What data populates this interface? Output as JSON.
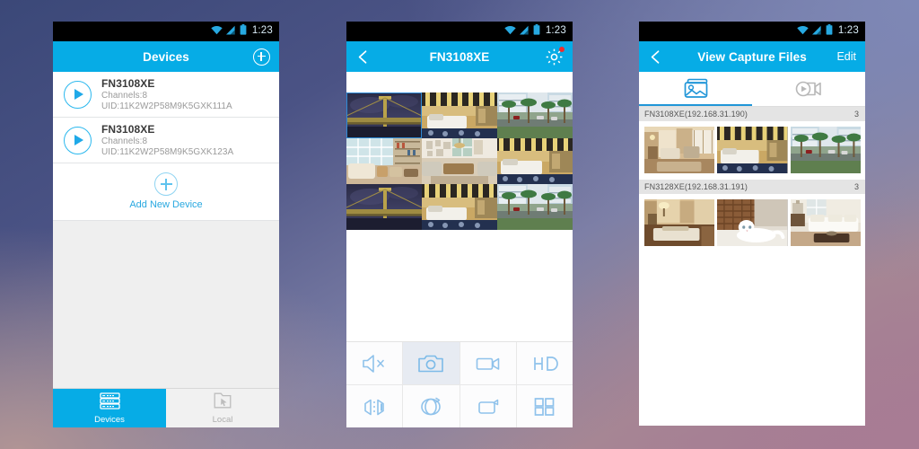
{
  "statusbar": {
    "time": "1:23",
    "wifi_icon": "wifi-icon",
    "signal_icon": "signal-bars-icon",
    "battery_icon": "battery-icon"
  },
  "phone1": {
    "appbar": {
      "title": "Devices",
      "add_icon": "plus-circle-icon"
    },
    "devices": [
      {
        "name": "FN3108XE",
        "channels": "Channels:8",
        "uid": "UID:11K2W2P58M9K5GXK111A",
        "play_icon": "play-icon"
      },
      {
        "name": "FN3108XE",
        "channels": "Channels:8",
        "uid": "UID:11K2W2P58M9K5GXK123A",
        "play_icon": "play-icon"
      }
    ],
    "add_new": {
      "label": "Add New Device",
      "icon": "plus-circle-icon"
    },
    "tabs": [
      {
        "label": "Devices",
        "icon": "server-rack-icon",
        "active": true
      },
      {
        "label": "Local",
        "icon": "folder-cursor-icon",
        "active": false
      }
    ]
  },
  "phone2": {
    "appbar": {
      "title": "FN3108XE",
      "back_icon": "back-chevron-icon",
      "settings_icon": "gear-icon",
      "badge": true
    },
    "grid": {
      "rows": 3,
      "cols": 3,
      "cells": [
        {
          "scene": "bridge-night",
          "selected": true
        },
        {
          "scene": "hotel-room",
          "selected": false
        },
        {
          "scene": "street-palms",
          "selected": false
        },
        {
          "scene": "sunroom",
          "selected": false
        },
        {
          "scene": "living-room",
          "selected": false
        },
        {
          "scene": "hotel-room",
          "selected": false
        },
        {
          "scene": "bridge-night",
          "selected": false
        },
        {
          "scene": "hotel-room",
          "selected": false
        },
        {
          "scene": "street-palms",
          "selected": false
        }
      ]
    },
    "controls": [
      {
        "name": "mute-button",
        "icon": "speaker-mute-icon",
        "active": false
      },
      {
        "name": "snapshot-button",
        "icon": "camera-icon",
        "active": true
      },
      {
        "name": "record-button",
        "icon": "video-camera-icon",
        "active": false
      },
      {
        "name": "quality-button",
        "icon": "hd-icon",
        "active": false
      },
      {
        "name": "mirror-button",
        "icon": "flip-mirror-icon",
        "active": false
      },
      {
        "name": "ptz-button",
        "icon": "ptz-rotate-icon",
        "active": false
      },
      {
        "name": "fullscreen-button",
        "icon": "fullscreen-icon",
        "active": false
      },
      {
        "name": "layout-button",
        "icon": "grid-four-icon",
        "active": false
      }
    ]
  },
  "phone3": {
    "appbar": {
      "title": "View Capture Files",
      "back_icon": "back-chevron-icon",
      "edit_label": "Edit"
    },
    "media_tabs": [
      {
        "name": "photos-tab",
        "icon": "photo-stack-icon",
        "active": true
      },
      {
        "name": "videos-tab",
        "icon": "video-play-icon",
        "active": false
      }
    ],
    "groups": [
      {
        "name": "FN3108XE(192.168.31.190)",
        "count": "3",
        "thumbs": [
          {
            "scene": "warm-suite"
          },
          {
            "scene": "hotel-room"
          },
          {
            "scene": "street-palms"
          }
        ]
      },
      {
        "name": "FN3128XE(192.168.31.191)",
        "count": "3",
        "thumbs": [
          {
            "scene": "bedroom-lamp"
          },
          {
            "scene": "white-cat"
          },
          {
            "scene": "white-sofa"
          }
        ]
      }
    ]
  },
  "colors": {
    "accent": "#06ACE6",
    "accent_light": "#2BB8EE",
    "tab_active_bg": "#06ACE6",
    "tab_inactive_bg": "#F1F1F1",
    "group_header_bg": "#E4E4E4",
    "badge_red": "#EF2D2D",
    "selection_border": "#2E8BD6"
  }
}
